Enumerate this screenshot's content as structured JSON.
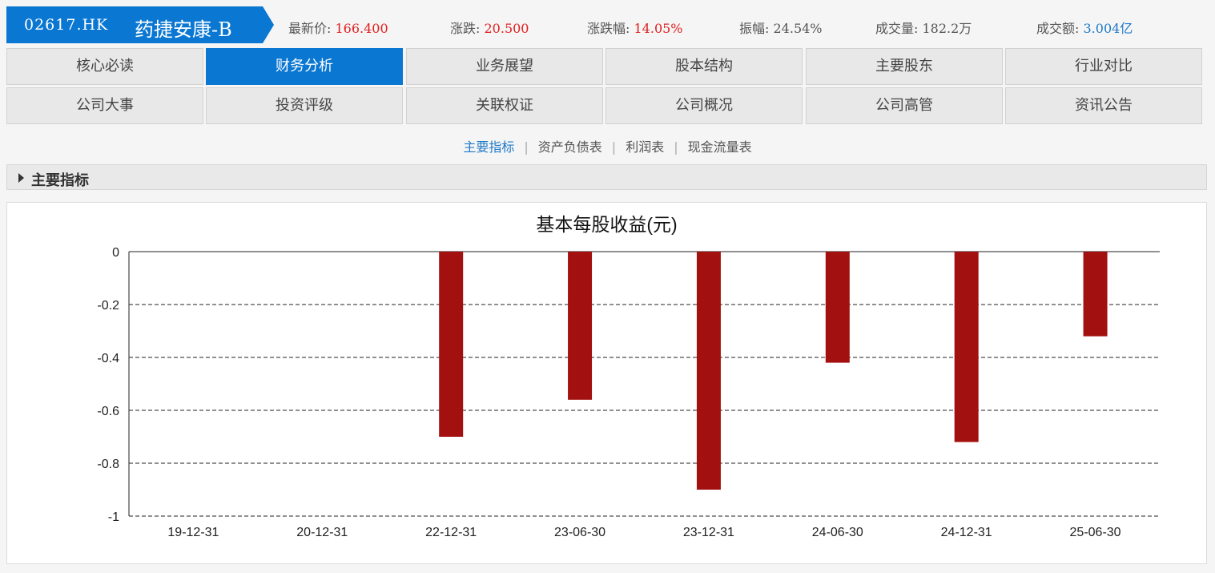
{
  "header": {
    "code": "02617.HK",
    "name": "药捷安康-B",
    "quotes": [
      {
        "label": "最新价:",
        "value": "166.400",
        "color": "red"
      },
      {
        "label": "涨跌:",
        "value": "20.500",
        "color": "red"
      },
      {
        "label": "涨跌幅:",
        "value": "14.05%",
        "color": "red"
      },
      {
        "label": "振幅:",
        "value": "24.54%",
        "color": "gray"
      },
      {
        "label": "成交量:",
        "value": "182.2万",
        "color": "gray"
      },
      {
        "label": "成交额:",
        "value": "3.004亿",
        "color": "blue"
      }
    ]
  },
  "tabs": {
    "row1": [
      "核心必读",
      "财务分析",
      "业务展望",
      "股本结构",
      "主要股东",
      "行业对比"
    ],
    "row2": [
      "公司大事",
      "投资评级",
      "关联权证",
      "公司概况",
      "公司高管",
      "资讯公告"
    ],
    "active": "财务分析"
  },
  "subnav": {
    "items": [
      "主要指标",
      "资产负债表",
      "利润表",
      "现金流量表"
    ],
    "active": "主要指标"
  },
  "section": {
    "title": "主要指标"
  },
  "colors": {
    "accent": "#0a77d2",
    "bar": "#a31010",
    "up": "#e02020"
  },
  "chart_data": {
    "type": "bar",
    "title": "基本每股收益(元)",
    "categories": [
      "19-12-31",
      "20-12-31",
      "22-12-31",
      "23-06-30",
      "23-12-31",
      "24-06-30",
      "24-12-31",
      "25-06-30"
    ],
    "values": [
      null,
      null,
      -0.7,
      -0.56,
      -0.9,
      -0.42,
      -0.72,
      -0.32
    ],
    "ylim": [
      -1,
      0
    ],
    "yticks": [
      "0",
      "-0.2",
      "-0.4",
      "-0.6",
      "-0.8",
      "-1"
    ],
    "xlabel": "",
    "ylabel": "",
    "grid": true
  }
}
